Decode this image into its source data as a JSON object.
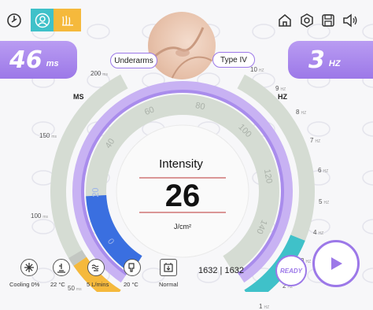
{
  "header": {
    "icons": [
      "power-icon",
      "user-icon",
      "hair-icon",
      "home-icon",
      "settings-icon",
      "save-icon",
      "volume-icon"
    ]
  },
  "pulse": {
    "value": "46",
    "unit": "ms"
  },
  "frequency": {
    "value": "3",
    "unit": "HZ"
  },
  "treatment": {
    "area": "Underarms",
    "skin_type": "Type IV"
  },
  "ms_scale": {
    "title": "MS",
    "ticks": [
      "200",
      "150",
      "100",
      "50"
    ],
    "tick_unit": "ms",
    "level_fraction": 0.23
  },
  "hz_scale": {
    "title": "HZ",
    "ticks": [
      "10",
      "9",
      "8",
      "7",
      "6",
      "5",
      "4",
      "3",
      "2",
      "1"
    ],
    "tick_unit": "HZ",
    "level_fraction": 0.3
  },
  "intensity": {
    "label": "Intensity",
    "value": "26",
    "unit": "J/cm²",
    "dial_ticks": [
      "0",
      "20",
      "40",
      "60",
      "80",
      "100",
      "120",
      "140"
    ],
    "level_fraction": 0.186
  },
  "status": {
    "cooling": {
      "label": "Cooling",
      "value": "0%"
    },
    "water_level": {
      "value": "22",
      "unit": "°C"
    },
    "flow": {
      "value": "5",
      "unit": "L/mins"
    },
    "handle_temp": {
      "value": "20",
      "unit": "°C"
    },
    "state": {
      "label": "Normal"
    }
  },
  "counter": {
    "current": "1632",
    "separator": "|",
    "total": "1632"
  },
  "controls": {
    "ready_label": "READY"
  },
  "colors": {
    "accent": "#9c78e8",
    "teal": "#3fc1c9",
    "ms_fill": "#f5b93c",
    "intensity_fill": "#3a6fe0",
    "track": "#d5dcd3"
  }
}
